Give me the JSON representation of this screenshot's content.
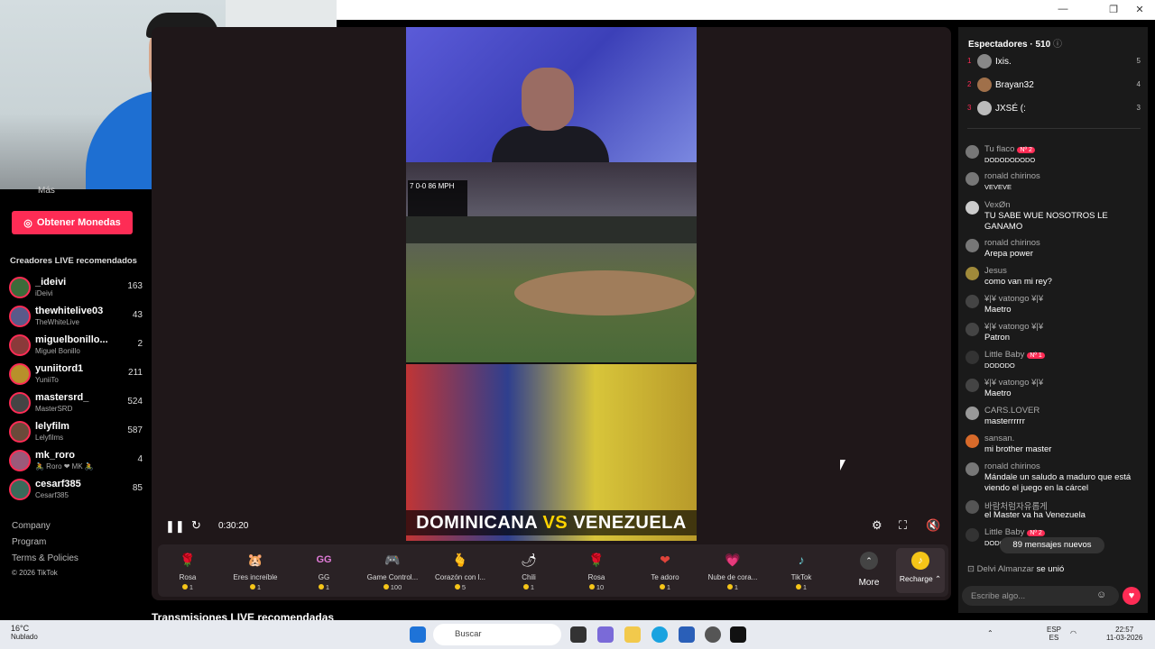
{
  "window": {
    "minimize": "—",
    "maximize": "❐",
    "close": "✕"
  },
  "sidebar": {
    "mas": "Más",
    "coins_button": "Obtener Monedas",
    "recommended_title": "Creadores LIVE recomendados",
    "creators": [
      {
        "name": "_ideivi",
        "sub": "iDeivi",
        "count": "163",
        "color": "#3d6b3a"
      },
      {
        "name": "thewhitelive03",
        "sub": "TheWhiteLive",
        "count": "43",
        "color": "#5a5a8a"
      },
      {
        "name": "miguelbonillo...",
        "sub": "Miguel Bonillo",
        "count": "2",
        "color": "#8a3a3a"
      },
      {
        "name": "yuniitord1",
        "sub": "YuniiTo",
        "count": "211",
        "color": "#b8902a"
      },
      {
        "name": "mastersrd_",
        "sub": "MasterSRD",
        "count": "524",
        "color": "#444"
      },
      {
        "name": "lelyfilm",
        "sub": "Lelyfilms",
        "count": "587",
        "color": "#6a4a3a"
      },
      {
        "name": "mk_roro",
        "sub": "🚴 Roro ❤ MK 🚴",
        "count": "4",
        "color": "#9a5a7a"
      },
      {
        "name": "cesarf385",
        "sub": "Cesarf385",
        "count": "85",
        "color": "#3a6a5a"
      }
    ],
    "footer": [
      "Company",
      "Program",
      "Terms & Policies",
      "© 2026 TikTok"
    ]
  },
  "video": {
    "timer": "0:30:20",
    "scoreboard": "7 0-0 86 MPH",
    "banner_left": "DOMINICANA",
    "banner_vs": "VS",
    "banner_right": "VENEZUELA"
  },
  "gifts": [
    {
      "name": "Rosa",
      "price": "1",
      "icon": "🌹"
    },
    {
      "name": "Eres increíble",
      "price": "1",
      "icon": "🐹"
    },
    {
      "name": "GG",
      "price": "1",
      "icon": "GG"
    },
    {
      "name": "Game Control...",
      "price": "100",
      "icon": "🎮"
    },
    {
      "name": "Corazón con l...",
      "price": "5",
      "icon": "🫰"
    },
    {
      "name": "Chili",
      "price": "1",
      "icon": "🌶"
    },
    {
      "name": "Rosa",
      "price": "10",
      "icon": "🌹"
    },
    {
      "name": "Te adoro",
      "price": "1",
      "icon": "❤"
    },
    {
      "name": "Nube de cora...",
      "price": "1",
      "icon": "💗"
    },
    {
      "name": "TikTok",
      "price": "1",
      "icon": "♪"
    }
  ],
  "gift_more": "More",
  "recharge": "Recharge",
  "bottom_title": "Transmisiones LIVE recomendadas",
  "chat": {
    "spectators_label": "Espectadores · 510",
    "top_viewers": [
      {
        "rank": "1",
        "name": "Ixis.",
        "score": "5"
      },
      {
        "rank": "2",
        "name": "Brayan32",
        "score": "4"
      },
      {
        "rank": "3",
        "name": "JXSÉ (:",
        "score": "3"
      }
    ],
    "messages": [
      {
        "user": "Tu flaco",
        "badge": "Nº 2",
        "text": "DODODODODO"
      },
      {
        "user": "ronald chirinos",
        "badge": "",
        "text": "VEVEVE"
      },
      {
        "user": "VexØn",
        "badge": "",
        "text": "TU SABE WUE NOSOTROS LE GANAMO"
      },
      {
        "user": "ronald chirinos",
        "badge": "",
        "text": "Arepa power"
      },
      {
        "user": "Jesus",
        "badge": "",
        "text": "como van mi rey?"
      },
      {
        "user": "¥|¥ vatongo ¥|¥",
        "badge": "",
        "text": "Maetro"
      },
      {
        "user": "¥|¥ vatongo ¥|¥",
        "badge": "",
        "text": "Patron"
      },
      {
        "user": "Little Baby",
        "badge": "Nº 1",
        "text": "DODODO"
      },
      {
        "user": "¥|¥ vatongo ¥|¥",
        "badge": "",
        "text": "Maetro"
      },
      {
        "user": "CARS.LOVER",
        "badge": "",
        "text": "masterrrrrr"
      },
      {
        "user": "sansan.",
        "badge": "",
        "text": "mi brother master"
      },
      {
        "user": "ronald chirinos",
        "badge": "",
        "text": "Mándale un saludo a maduro que está viendo el juego en la cárcel"
      },
      {
        "user": "바람처럼자유롭게",
        "badge": "",
        "text": "el Master va ha Venezuela"
      },
      {
        "user": "Little Baby",
        "badge": "Nº 2",
        "text": "DODO"
      }
    ],
    "new_messages": "89 mensajes nuevos",
    "joined_user": "Delvi Almanzar",
    "joined_text": "se unió",
    "input_placeholder": "Escribe algo..."
  },
  "taskbar": {
    "temp": "16°C",
    "weather": "Nublado",
    "search": "Buscar",
    "lang_top": "ESP",
    "lang_bottom": "ES",
    "time": "22:57",
    "date": "11-03-2026"
  }
}
